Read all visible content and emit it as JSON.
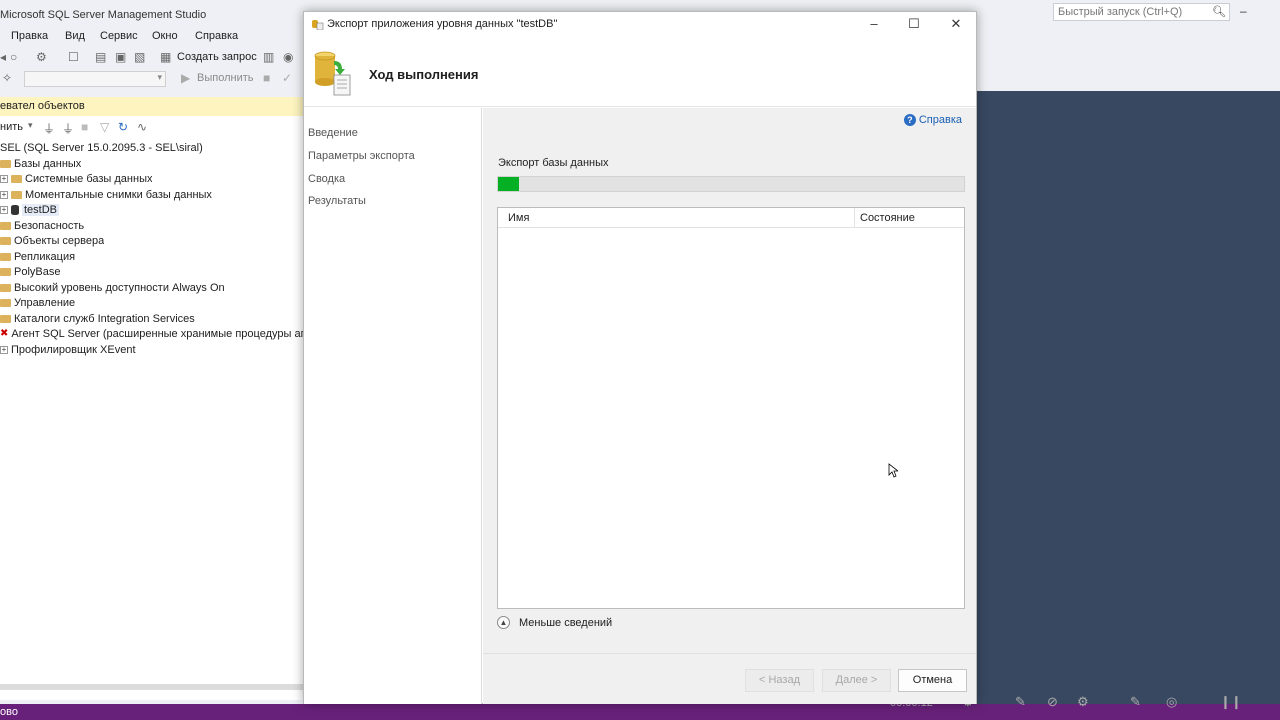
{
  "app": {
    "title": "Microsoft SQL Server Management Studio",
    "quick_launch_placeholder": "Быстрый запуск (Ctrl+Q)",
    "status_text": "ово"
  },
  "menu": [
    "Правка",
    "Вид",
    "Сервис",
    "Окно",
    "Справка"
  ],
  "toolbar": {
    "new_query": "Создать запрос",
    "execute": "Выполнить"
  },
  "object_explorer": {
    "header": "евател объектов",
    "connect_label": "нить",
    "tree": [
      "SEL (SQL Server 15.0.2095.3 - SEL\\siral)",
      "Базы данных",
      "Системные базы данных",
      "Моментальные снимки базы данных",
      "testDB",
      "Безопасность",
      "Объекты сервера",
      "Репликация",
      "PolyBase",
      "Высокий уровень доступности Always On",
      "Управление",
      "Каталоги служб Integration Services",
      "Агент SQL Server (расширенные хранимые процедуры агента отключены)",
      "Профилировщик XEvent"
    ]
  },
  "dialog": {
    "title": "Экспорт приложения уровня данных \"testDB\"",
    "heading": "Ход выполнения",
    "nav": [
      "Введение",
      "Параметры экспорта",
      "Сводка",
      "Результаты"
    ],
    "help": "Справка",
    "export_label": "Экспорт базы данных",
    "progress": 0.045,
    "columns": [
      "Имя",
      "Состояние"
    ],
    "less_details": "Меньше сведений",
    "buttons": {
      "back": "< Назад",
      "next": "Далее >",
      "cancel": "Отмена"
    }
  },
  "colors": {
    "status_bar": "#68217a",
    "desktop_bg": "#384861",
    "progress_fill": "#06b025",
    "oe_header": "#fdf4bf"
  }
}
